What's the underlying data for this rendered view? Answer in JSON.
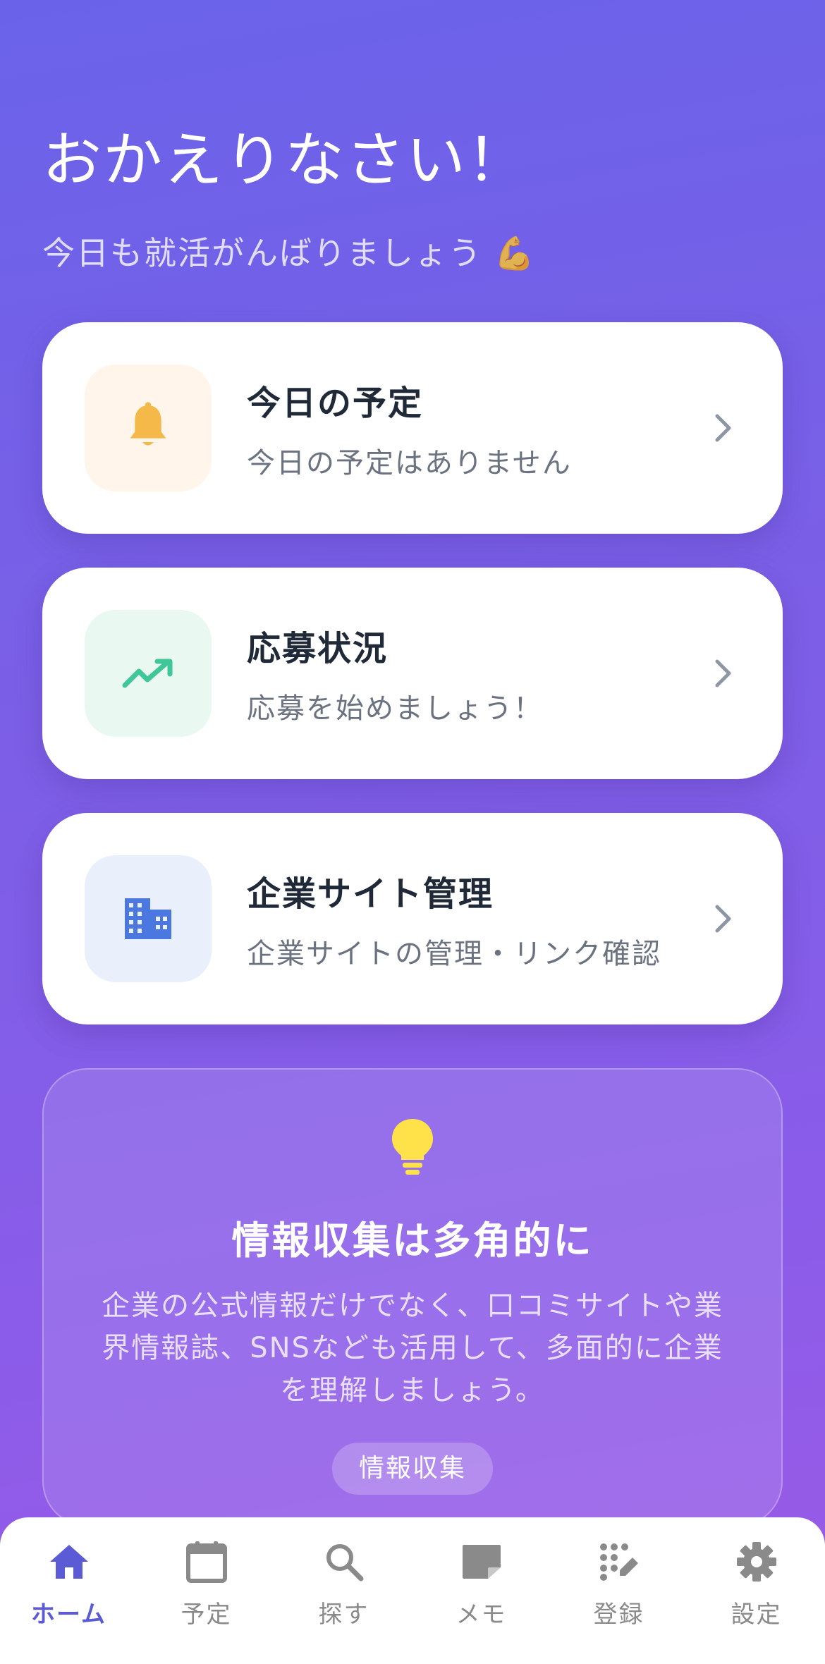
{
  "header": {
    "title": "おかえりなさい！",
    "subtitle": "今日も就活がんばりましょう 💪"
  },
  "cards": [
    {
      "title": "今日の予定",
      "description": "今日の予定はありません",
      "icon": "bell-icon",
      "icon_bg": "#fff5ea",
      "icon_color": "#f5b94a"
    },
    {
      "title": "応募状況",
      "description": "応募を始めましょう！",
      "icon": "trending-up-icon",
      "icon_bg": "#e9f8f1",
      "icon_color": "#3fc79a"
    },
    {
      "title": "企業サイト管理",
      "description": "企業サイトの管理・リンク確認",
      "icon": "building-icon",
      "icon_bg": "#eaf0fb",
      "icon_color": "#4a78e0"
    }
  ],
  "tip": {
    "icon": "lightbulb-icon",
    "title": "情報収集は多角的に",
    "body": "企業の公式情報だけでなく、口コミサイトや業界情報誌、SNSなども活用して、多面的に企業を理解しましょう。",
    "button_label": "情報収集"
  },
  "tabbar": {
    "items": [
      {
        "label": "ホーム",
        "icon": "home-icon",
        "active": true
      },
      {
        "label": "予定",
        "icon": "calendar-icon",
        "active": false
      },
      {
        "label": "探す",
        "icon": "search-icon",
        "active": false
      },
      {
        "label": "メモ",
        "icon": "note-icon",
        "active": false
      },
      {
        "label": "登録",
        "icon": "register-icon",
        "active": false
      },
      {
        "label": "設定",
        "icon": "gear-icon",
        "active": false
      }
    ]
  },
  "colors": {
    "accent": "#5b5bd6",
    "bg_top": "#6a63ea",
    "bg_bottom": "#9a5ae6"
  }
}
